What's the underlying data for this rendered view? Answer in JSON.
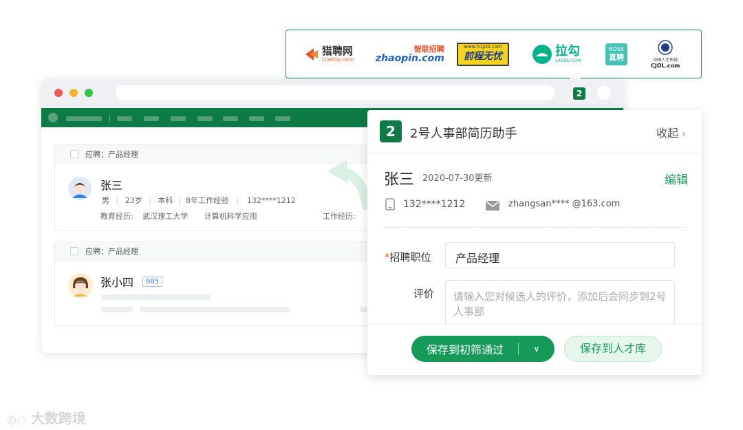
{
  "colors": {
    "brand_green": "#0d7b45",
    "accent_green": "#159a5a",
    "required_star": "#e25b3c"
  },
  "logos": [
    {
      "name": "猎聘网",
      "sub": "Liietou.com",
      "color": "#e8552b",
      "icon": "liepin-logo"
    },
    {
      "name": "zhaopin.com",
      "sub": "智联招聘",
      "color": "#1f62c4",
      "icon": "zhaopin-logo"
    },
    {
      "name": "前程无忧",
      "sub": "www.51job.com",
      "color": "#e0a800",
      "icon": "51job-logo"
    },
    {
      "name": "拉勾",
      "sub": "LAGOU.COM",
      "color": "#00b38a",
      "icon": "lagou-logo"
    },
    {
      "name": "直聘",
      "sub": "BOSS",
      "color": "#46c3b5",
      "icon": "boss-logo"
    },
    {
      "name": "CJOL.com",
      "sub": "中国人才热线",
      "color": "#222222",
      "icon": "cjol-logo"
    }
  ],
  "browser": {
    "extension_icon": "2"
  },
  "cards": [
    {
      "applied_label": "应聘：产品经理",
      "name": "张三",
      "gender": "男",
      "age": "23岁",
      "degree": "本科",
      "experience": "8年工作经验",
      "phone": "132****1212",
      "edu_label": "教育经历:",
      "school": "武汉理工大学",
      "major": "计算机科学应用",
      "work_label": "工作经历:"
    },
    {
      "applied_label": "应聘：产品经理",
      "name": "张小四",
      "badge": "985"
    }
  ],
  "panel": {
    "logo_text": "2",
    "title": "2号人事部简历助手",
    "collapse_label": "收起",
    "candidate_name": "张三",
    "updated": "2020-07-30更新",
    "edit_label": "编辑",
    "phone": "132****1212",
    "email": "zhangsan**** @163.com",
    "position_label": "招聘职位",
    "position_required": "*",
    "position_value": "产品经理",
    "eval_label": "评价",
    "eval_placeholder": "请输入您对候选人的评价，添加后会同步到2号人事部",
    "save_primary": "保存到初筛通过",
    "save_secondary": "保存到人才库"
  },
  "watermark": "大数跨境"
}
